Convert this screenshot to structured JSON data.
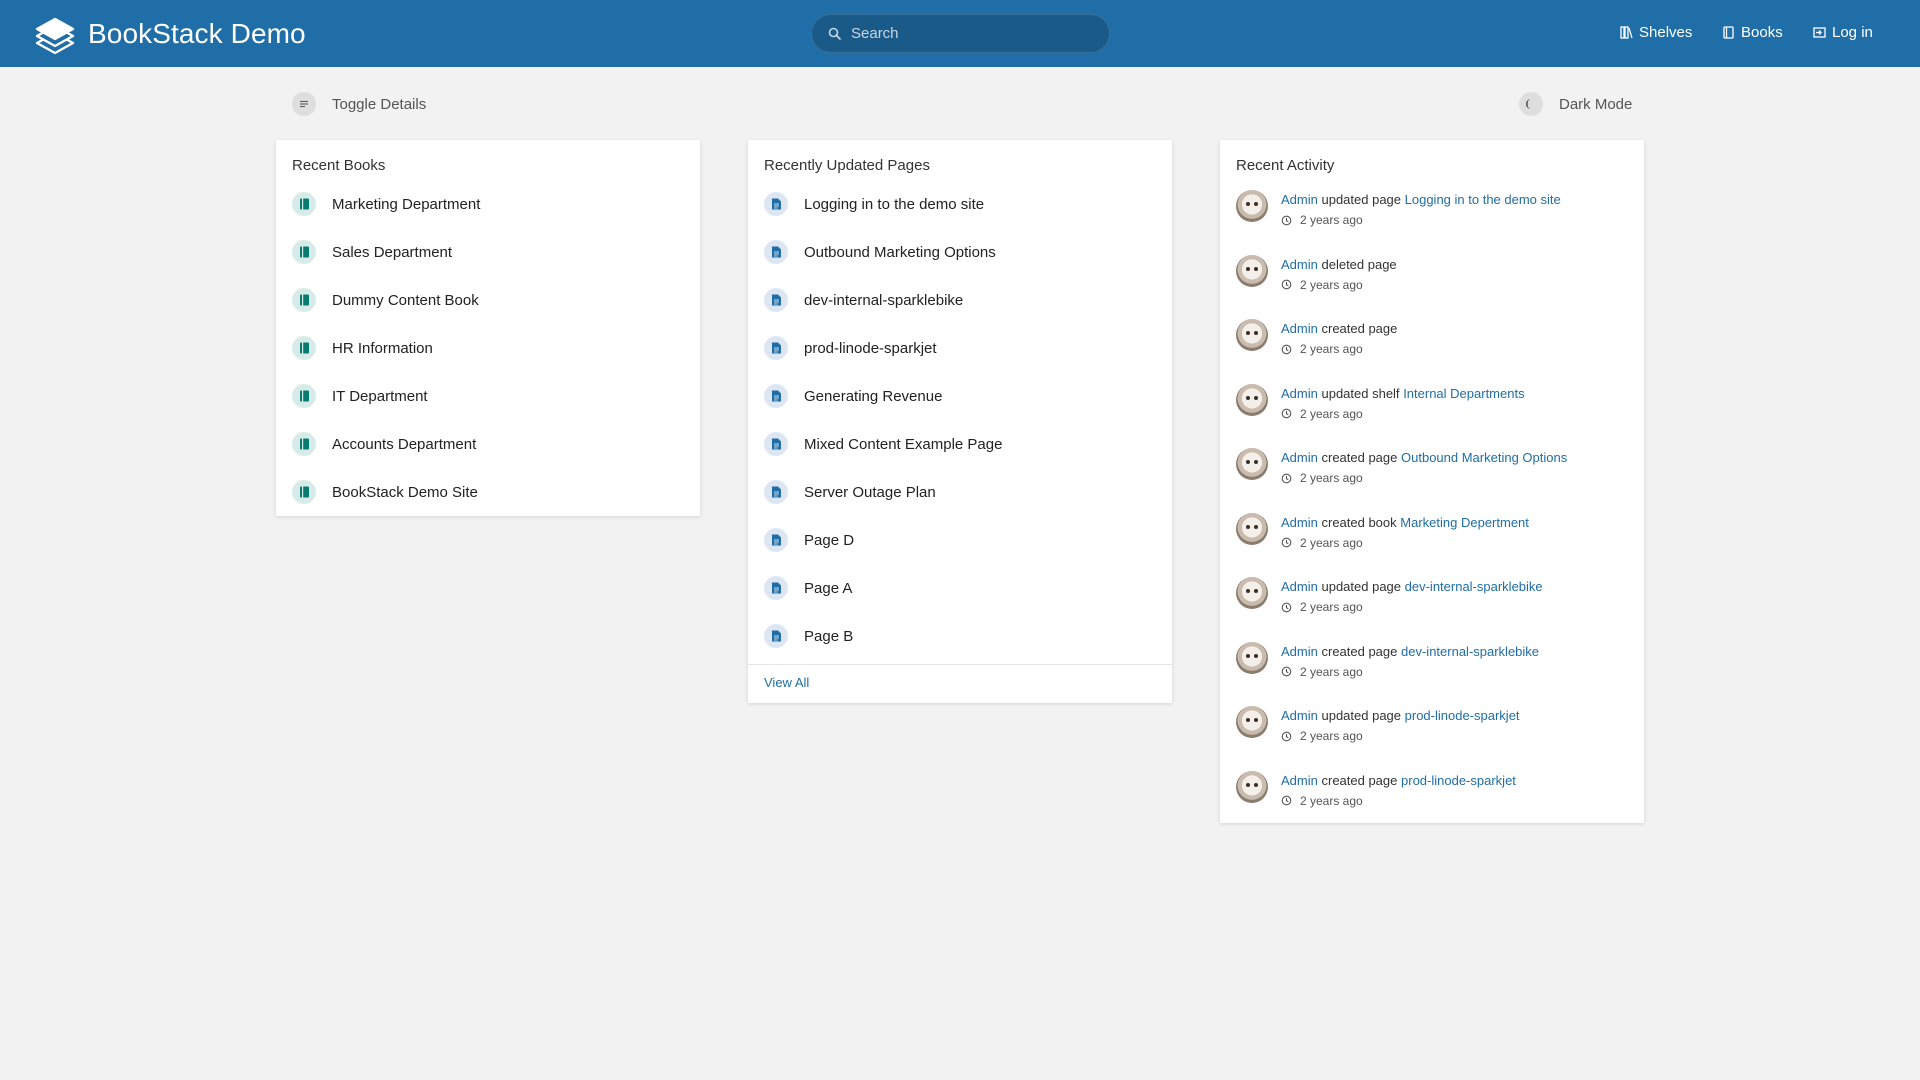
{
  "header": {
    "title": "BookStack Demo",
    "search_placeholder": "Search",
    "nav": {
      "shelves": "Shelves",
      "books": "Books",
      "login": "Log in"
    }
  },
  "toolbar": {
    "toggle_details": "Toggle Details",
    "dark_mode": "Dark Mode"
  },
  "recent_books": {
    "title": "Recent Books",
    "items": [
      "Marketing Department",
      "Sales Department",
      "Dummy Content Book",
      "HR Information",
      "IT Department",
      "Accounts Department",
      "BookStack Demo Site"
    ]
  },
  "recent_pages": {
    "title": "Recently Updated Pages",
    "items": [
      "Logging in to the demo site",
      "Outbound Marketing Options",
      "dev-internal-sparklebike",
      "prod-linode-sparkjet",
      "Generating Revenue",
      "Mixed Content Example Page",
      "Server Outage Plan",
      "Page D",
      "Page A",
      "Page B"
    ],
    "view_all": "View All"
  },
  "recent_activity": {
    "title": "Recent Activity",
    "items": [
      {
        "user": "Admin",
        "action": "updated page",
        "target": "Logging in to the demo site",
        "time": "2 years ago"
      },
      {
        "user": "Admin",
        "action": "deleted page",
        "target": "",
        "time": "2 years ago"
      },
      {
        "user": "Admin",
        "action": "created page",
        "target": "",
        "time": "2 years ago"
      },
      {
        "user": "Admin",
        "action": "updated shelf",
        "target": "Internal Departments",
        "time": "2 years ago"
      },
      {
        "user": "Admin",
        "action": "created page",
        "target": "Outbound Marketing Options",
        "time": "2 years ago"
      },
      {
        "user": "Admin",
        "action": "created book",
        "target": "Marketing Depertment",
        "time": "2 years ago"
      },
      {
        "user": "Admin",
        "action": "updated page",
        "target": "dev-internal-sparklebike",
        "time": "2 years ago"
      },
      {
        "user": "Admin",
        "action": "created page",
        "target": "dev-internal-sparklebike",
        "time": "2 years ago"
      },
      {
        "user": "Admin",
        "action": "updated page",
        "target": "prod-linode-sparkjet",
        "time": "2 years ago"
      },
      {
        "user": "Admin",
        "action": "created page",
        "target": "prod-linode-sparkjet",
        "time": "2 years ago"
      }
    ]
  },
  "colors": {
    "header": "#206ea7",
    "link": "#206ea7",
    "book_icon": "#077b70",
    "page_icon": "#206ea7",
    "background": "#f2f2f2"
  }
}
